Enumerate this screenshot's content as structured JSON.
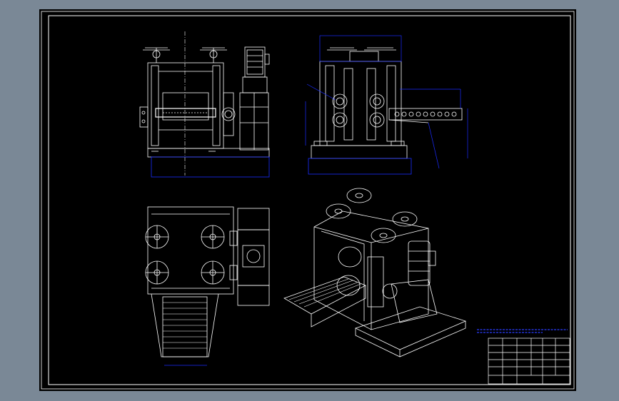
{
  "app": {
    "background_color": "#7a8896",
    "sheet_color": "#000000",
    "line_color": "#ffffff",
    "dimension_color": "#1a2cff",
    "note_color": "#2a3cff"
  },
  "drawing": {
    "views": [
      {
        "name": "front-view"
      },
      {
        "name": "side-view"
      },
      {
        "name": "top-view"
      },
      {
        "name": "isometric-view"
      }
    ],
    "title_block": {
      "rows": 6,
      "columns": 6
    }
  }
}
